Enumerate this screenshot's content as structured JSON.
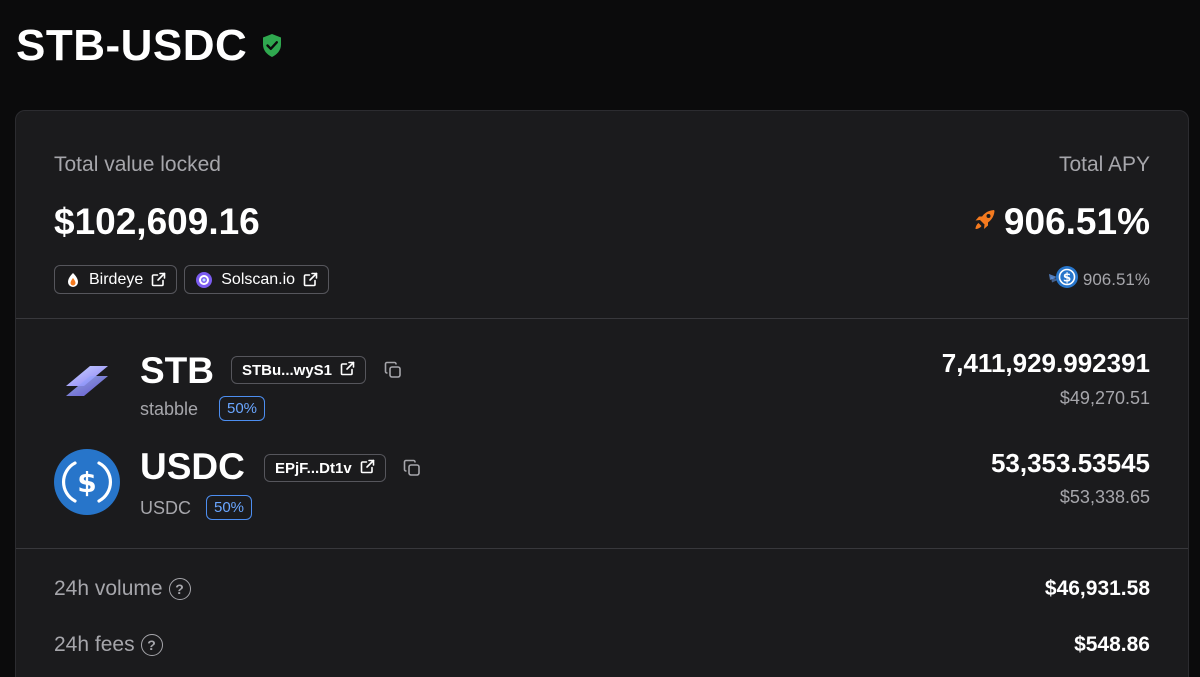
{
  "pool": {
    "title": "STB-USDC",
    "verified_icon": "shield-check-icon"
  },
  "tvl": {
    "label": "Total value locked",
    "value": "$102,609.16"
  },
  "apy": {
    "label": "Total APY",
    "value": "906.51%",
    "reward_value": "906.51%",
    "accent": "#f47a1f"
  },
  "links": [
    {
      "label": "Birdeye",
      "icon": "birdeye-icon"
    },
    {
      "label": "Solscan.io",
      "icon": "solscan-icon"
    }
  ],
  "tokens": [
    {
      "symbol": "STB",
      "address": "STBu...wyS1",
      "name": "stabble",
      "weight": "50%",
      "amount": "7,411,929.992391",
      "usd": "$49,270.51"
    },
    {
      "symbol": "USDC",
      "address": "EPjF...Dt1v",
      "name": "USDC",
      "weight": "50%",
      "amount": "53,353.53545",
      "usd": "$53,338.65"
    }
  ],
  "stats": {
    "volume_24h": {
      "label": "24h volume",
      "value": "$46,931.58"
    },
    "fees_24h": {
      "label": "24h fees",
      "value": "$548.86"
    }
  },
  "colors": {
    "background": "#0b0b0c",
    "card": "#1b1b1d",
    "weight_badge": "#4d8ef0",
    "verified": "#2fa84f",
    "usdc": "#2775ca"
  }
}
